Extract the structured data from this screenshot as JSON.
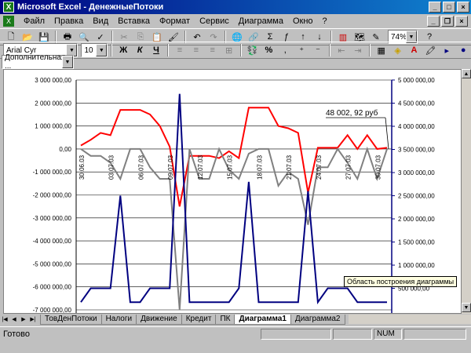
{
  "window": {
    "title": "Microsoft Excel - ДенежныеПотоки"
  },
  "menu": [
    "Файл",
    "Правка",
    "Вид",
    "Вставка",
    "Формат",
    "Сервис",
    "Диаграмма",
    "Окно",
    "?"
  ],
  "toolbar": {
    "zoom": "74%",
    "font_name": "Arial Cyr",
    "font_size": "10",
    "bold": "Ж",
    "italic": "К",
    "underline": "Ч",
    "percent": "%"
  },
  "namebox": {
    "value": "Дополнительная ..."
  },
  "tabs": [
    "ТовДенПотоки",
    "Налоги",
    "Движение",
    "Кредит",
    "ПК",
    "Диаграмма1",
    "Диаграмма2"
  ],
  "active_tab": "Диаграмма1",
  "status": {
    "ready": "Готово",
    "num": "NUM"
  },
  "tooltip": "Область построения диаграммы",
  "chart_data": {
    "type": "line",
    "annotation": "48 002, 92 руб",
    "left_axis": {
      "ylim": [
        -7000000,
        3000000
      ],
      "ticks": [
        "3 000 000,00",
        "2 000 000,00",
        "1 000 000,00",
        "0,00",
        "-1 000 000,00",
        "-2 000 000,00",
        "-3 000 000,00",
        "-4 000 000,00",
        "-5 000 000,00",
        "-6 000 000,00",
        "-7 000 000,00"
      ],
      "tick_values": [
        3000000,
        2000000,
        1000000,
        0,
        -1000000,
        -2000000,
        -3000000,
        -4000000,
        -5000000,
        -6000000,
        -7000000
      ]
    },
    "right_axis": {
      "ylim": [
        500000,
        5000000
      ],
      "ticks": [
        "5 000 000,00",
        "4 500 000,00",
        "4 000 000,00",
        "3 500 000,00",
        "3 000 000,00",
        "2 500 000,00",
        "2 000 000,00",
        "1 500 000,00",
        "1 000 000,00",
        "500 000,00"
      ],
      "tick_values": [
        5000000,
        4500000,
        4000000,
        3500000,
        3000000,
        2500000,
        2000000,
        1500000,
        1000000,
        500000
      ]
    },
    "x_labels": [
      "30.06.03",
      "03.07.03",
      "06.07.03",
      "09.07.03",
      "12.07.03",
      "15.07.03",
      "18.07.03",
      "21.07.03",
      "24.07.03",
      "27.07.03",
      "30.07.03"
    ],
    "series": [
      {
        "color": "#ff0000",
        "axis": "left",
        "values": [
          150000,
          400000,
          700000,
          600000,
          1700000,
          1700000,
          1700000,
          1500000,
          1000000,
          100000,
          -2500000,
          -300000,
          -300000,
          -300000,
          -400000,
          -100000,
          -400000,
          1800000,
          1800000,
          1800000,
          1000000,
          900000,
          700000,
          -1900000,
          50000,
          50000,
          50000,
          600000,
          0,
          600000,
          0,
          50000
        ]
      },
      {
        "color": "#808080",
        "axis": "left",
        "values": [
          0,
          -300000,
          -300000,
          -600000,
          -1300000,
          0,
          0,
          -800000,
          -1300000,
          -1300000,
          -7000000,
          0,
          -1300000,
          -1300000,
          0,
          -900000,
          -1300000,
          -200000,
          0,
          0,
          -1600000,
          -1000000,
          -1300000,
          -3300000,
          -800000,
          -800000,
          0,
          -600000,
          -1300000,
          0,
          -1300000,
          0
        ]
      },
      {
        "color": "#000080",
        "axis": "right",
        "values": [
          200000,
          500000,
          500000,
          500000,
          2500000,
          200000,
          200000,
          500000,
          500000,
          500000,
          4700000,
          200000,
          200000,
          200000,
          200000,
          200000,
          500000,
          2800000,
          200000,
          200000,
          200000,
          200000,
          200000,
          2600000,
          200000,
          500000,
          500000,
          500000,
          200000,
          200000,
          200000,
          200000
        ]
      }
    ]
  }
}
